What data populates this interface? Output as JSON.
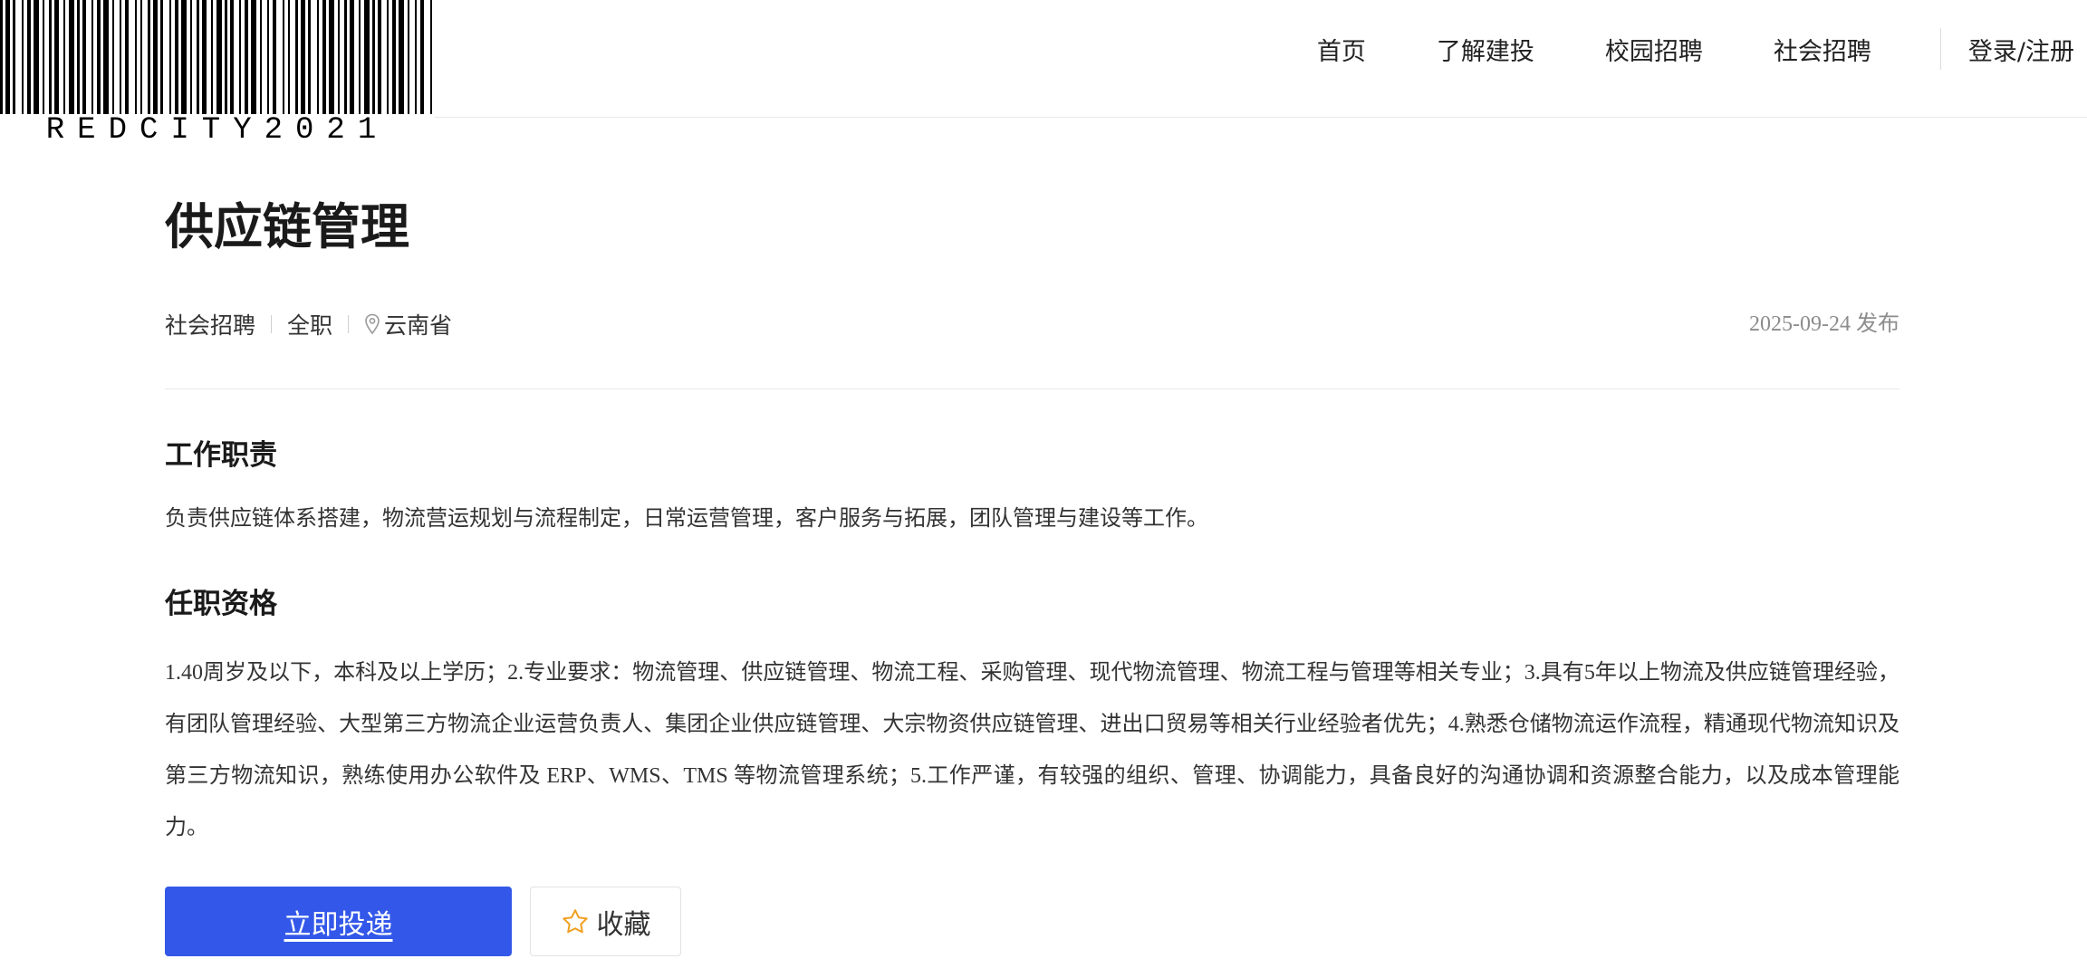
{
  "logo": {
    "barcode_text": "REDCITY2021"
  },
  "nav": {
    "items": [
      "首页",
      "了解建投",
      "校园招聘",
      "社会招聘"
    ],
    "login": "登录/注册"
  },
  "job": {
    "title": "供应链管理",
    "meta": {
      "category": "社会招聘",
      "type": "全职",
      "location": "云南省"
    },
    "publish_date": "2025-09-24 发布"
  },
  "sections": {
    "duties": {
      "title": "工作职责",
      "text": "负责供应链体系搭建，物流营运规划与流程制定，日常运营管理，客户服务与拓展，团队管理与建设等工作。"
    },
    "requirements": {
      "title": "任职资格",
      "text": "1.40周岁及以下，本科及以上学历；2.专业要求：物流管理、供应链管理、物流工程、采购管理、现代物流管理、物流工程与管理等相关专业；3.具有5年以上物流及供应链管理经验，有团队管理经验、大型第三方物流企业运营负责人、集团企业供应链管理、大宗物资供应链管理、进出口贸易等相关行业经验者优先；4.熟悉仓储物流运作流程，精通现代物流知识及第三方物流知识，熟练使用办公软件及 ERP、WMS、TMS 等物流管理系统；5.工作严谨，有较强的组织、管理、协调能力，具备良好的沟通协调和资源整合能力，以及成本管理能力。"
    }
  },
  "actions": {
    "apply_label": "立即投递",
    "favorite_label": "收藏"
  },
  "icons": {
    "location": "map-pin-icon",
    "favorite": "star-icon"
  },
  "colors": {
    "primary": "#3358e9",
    "star": "#f0a020",
    "muted": "#8c8c8c"
  }
}
